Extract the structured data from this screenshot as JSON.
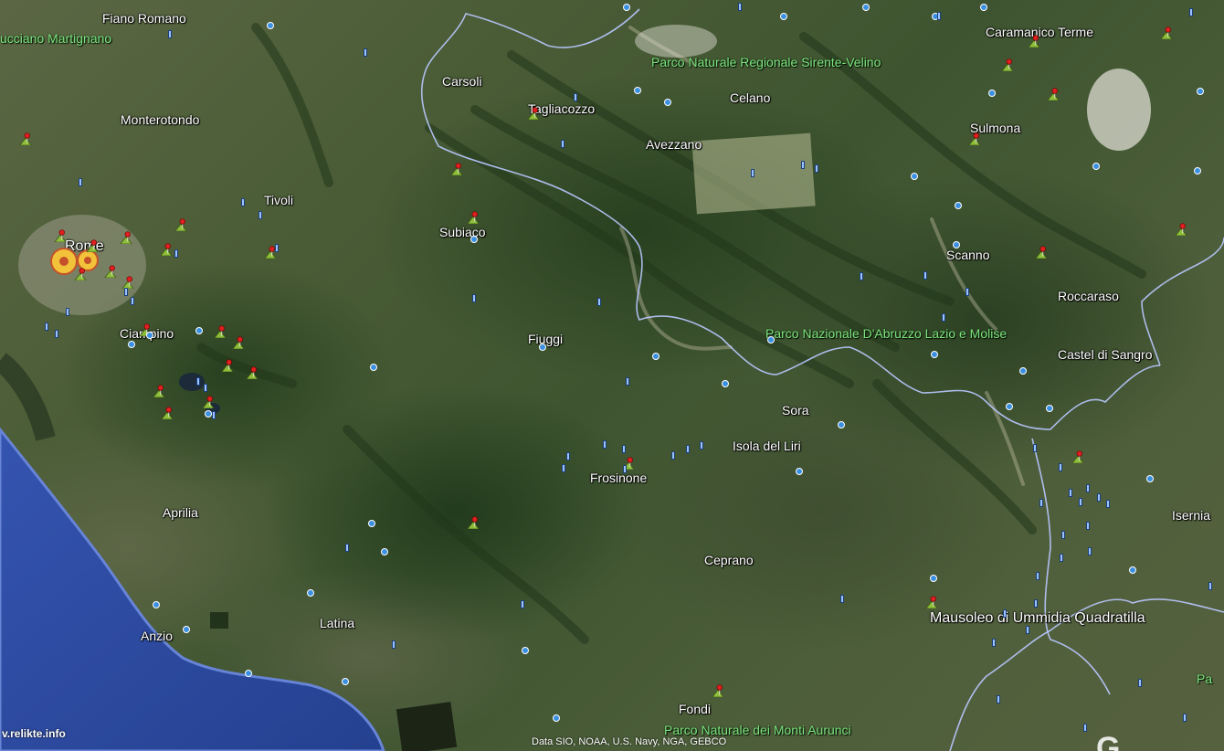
{
  "map": {
    "watermark": "v.relikte.info",
    "attribution": "Data SIO, NOAA, U.S. Navy, NGA, GEBCO",
    "google_logo": "G",
    "colors": {
      "sea": "#2f4fa8",
      "sea_edge": "#4a6bc4",
      "park_label": "#7fe27f",
      "border": "#b9c8ff",
      "pin_red": "#e02020",
      "pin_green": "#8fbf3a"
    }
  },
  "places": [
    {
      "id": "fiano-romano",
      "label": "Fiano Romano"
    },
    {
      "id": "ucciano-martignano",
      "label": "ucciano Martignano"
    },
    {
      "id": "monterotondo",
      "label": "Monterotondo"
    },
    {
      "id": "tivoli",
      "label": "Tivoli"
    },
    {
      "id": "rome",
      "label": "Rome"
    },
    {
      "id": "ciampino",
      "label": "Ciampino"
    },
    {
      "id": "aprilia",
      "label": "Aprilia"
    },
    {
      "id": "anzio",
      "label": "Anzio"
    },
    {
      "id": "latina",
      "label": "Latina"
    },
    {
      "id": "carsoli",
      "label": "Carsoli"
    },
    {
      "id": "tagliacozzo",
      "label": "Tagliacozzo"
    },
    {
      "id": "subiaco",
      "label": "Subiaco"
    },
    {
      "id": "fiuggi",
      "label": "Fiuggi"
    },
    {
      "id": "avezzano",
      "label": "Avezzano"
    },
    {
      "id": "celano",
      "label": "Celano"
    },
    {
      "id": "frosinone",
      "label": "Frosinone"
    },
    {
      "id": "ceprano",
      "label": "Ceprano"
    },
    {
      "id": "fondi",
      "label": "Fondi"
    },
    {
      "id": "sora",
      "label": "Sora"
    },
    {
      "id": "isola-del-liri",
      "label": "Isola del Liri"
    },
    {
      "id": "caramanico-terme",
      "label": "Caramanico Terme"
    },
    {
      "id": "sulmona",
      "label": "Sulmona"
    },
    {
      "id": "scanno",
      "label": "Scanno"
    },
    {
      "id": "roccaraso",
      "label": "Roccaraso"
    },
    {
      "id": "castel-di-sangro",
      "label": "Castel di Sangro"
    },
    {
      "id": "isernia",
      "label": "Isernia"
    },
    {
      "id": "mausoleo",
      "label": "Mausoleo di Ummidia Quadratilla"
    }
  ],
  "parks": [
    {
      "id": "sirente-velino",
      "label": "Parco Naturale Regionale Sirente-Velino"
    },
    {
      "id": "abruzzo",
      "label": "Parco Nazionale D'Abruzzo Lazio e Molise"
    },
    {
      "id": "monti-aurunci",
      "label": "Parco Naturale dei Monti Aurunci"
    },
    {
      "id": "pa-edge",
      "label": "Pa"
    }
  ]
}
